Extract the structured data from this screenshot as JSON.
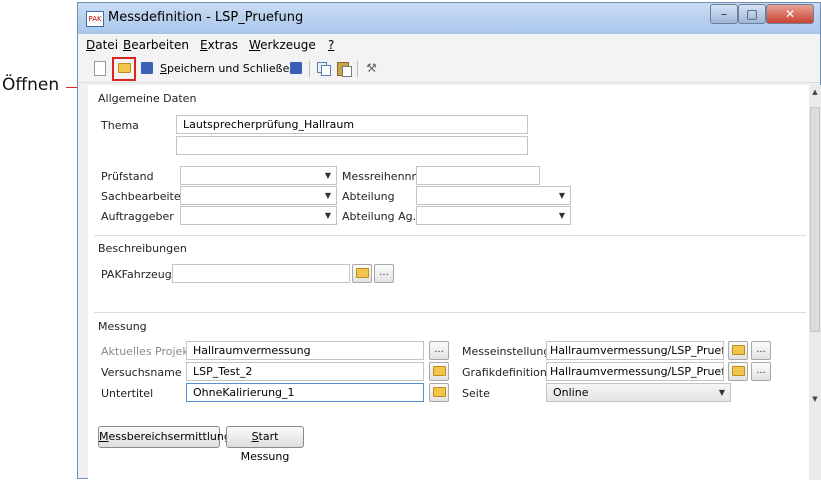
{
  "callout": {
    "label": "Öffnen"
  },
  "window": {
    "title": "Messdefinition - LSP_Pruefung",
    "app_icon": "PAK"
  },
  "menu": [
    {
      "key": "D",
      "rest": "atei"
    },
    {
      "key": "B",
      "rest": "earbeiten"
    },
    {
      "key": "E",
      "rest": "xtras"
    },
    {
      "key": "W",
      "rest": "erkzeuge"
    },
    {
      "key": "?",
      "rest": ""
    }
  ],
  "toolbar": {
    "save_close_key": "S",
    "save_close_rest": "peichern und Schließen"
  },
  "allgemeine": {
    "title": "Allgemeine Daten",
    "thema_label": "Thema",
    "thema_value": "Lautsprecherprüfung_Hallraum",
    "thema_value2": "",
    "pruefstand_label": "Prüfstand",
    "pruefstand_value": "",
    "messreihennr_label": "Messreihennr.",
    "messreihennr_value": "",
    "sachbearbeiter_label": "Sachbearbeiter",
    "sachbearbeiter_value": "",
    "abteilung_label": "Abteilung",
    "abteilung_value": "",
    "auftraggeber_label": "Auftraggeber",
    "auftraggeber_value": "",
    "abteilung_ag_label": "Abteilung Ag.",
    "abteilung_ag_value": ""
  },
  "beschreibungen": {
    "title": "Beschreibungen",
    "pakfahrzeug_label": "PAKFahrzeug",
    "pakfahrzeug_value": "",
    "more": "..."
  },
  "messung": {
    "title": "Messung",
    "aktuelles_projekt_label": "Aktuelles Projekt",
    "aktuelles_projekt_value": "Hallraumvermessung",
    "versuchsname_label": "Versuchsname",
    "versuchsname_value": "LSP_Test_2",
    "untertitel_label": "Untertitel",
    "untertitel_value": "OhneKalirierung_1",
    "messeinstellung_label": "Messeinstellung",
    "messeinstellung_value": "Hallraumvermessung/LSP_Pruefung",
    "grafikdefinition_label": "Grafikdefinition",
    "grafikdefinition_value": "Hallraumvermessung/LSP_Pruefung",
    "seite_label": "Seite",
    "seite_value": "Online",
    "more": "..."
  },
  "buttons": {
    "messbereich_key": "M",
    "messbereich_rest": "essbereichsermittlung",
    "start_key": "S",
    "start_rest": "tart Messung"
  },
  "colors": {
    "highlight": "#dd2222",
    "title_bar": "#b9d1ee",
    "close_button": "#c74333"
  }
}
